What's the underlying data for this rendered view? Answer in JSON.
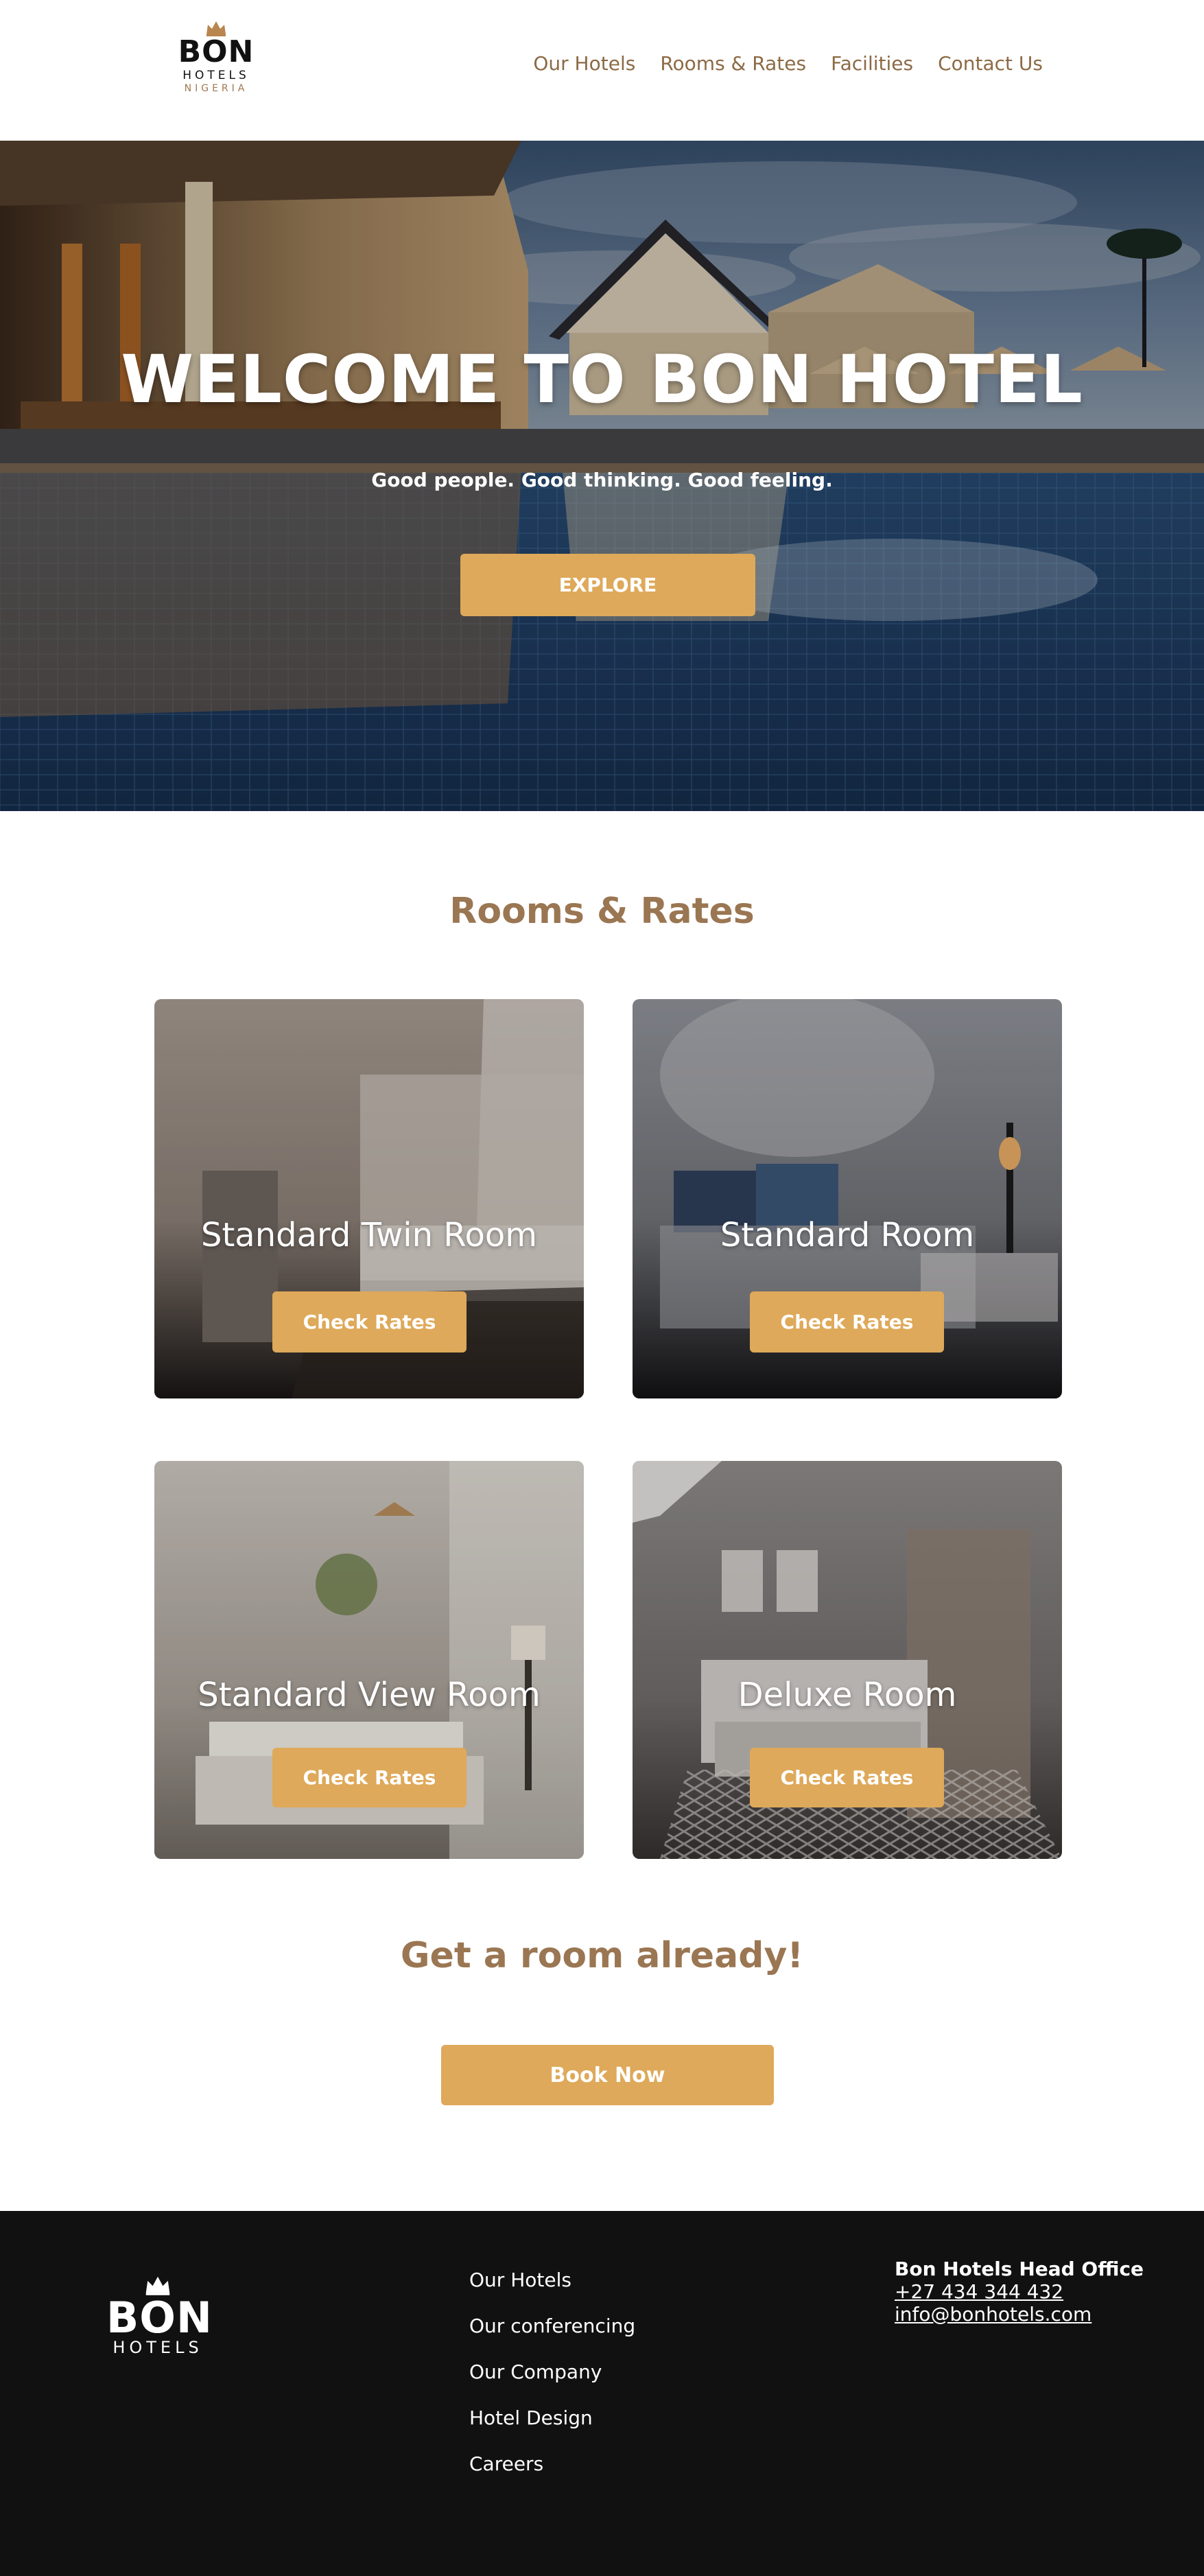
{
  "header": {
    "logo": {
      "line1": "BON",
      "line2": "HOTELS",
      "line3": "NIGERIA"
    },
    "nav": [
      {
        "label": "Our Hotels"
      },
      {
        "label": "Rooms & Rates"
      },
      {
        "label": "Facilities"
      },
      {
        "label": "Contact Us"
      }
    ]
  },
  "hero": {
    "title": "WELCOME TO BON HOTEL",
    "subtitle": "Good people. Good thinking. Good feeling.",
    "button": "EXPLORE"
  },
  "rooms": {
    "title": "Rooms & Rates",
    "cards": [
      {
        "title": "Standard Twin Room",
        "button": "Check Rates"
      },
      {
        "title": "Standard Room",
        "button": "Check Rates"
      },
      {
        "title": "Standard View Room",
        "button": "Check Rates"
      },
      {
        "title": "Deluxe Room",
        "button": "Check Rates"
      }
    ]
  },
  "cta": {
    "title": "Get a room already!",
    "button": "Book Now"
  },
  "footer": {
    "logo": {
      "line1": "BON",
      "line2": "HOTELS"
    },
    "links": [
      {
        "label": "Our Hotels"
      },
      {
        "label": "Our conferencing"
      },
      {
        "label": "Our Company"
      },
      {
        "label": "Hotel Design"
      },
      {
        "label": "Careers"
      }
    ],
    "contact": {
      "office": "Bon Hotels Head Office",
      "phone": "+27 434 344 432",
      "email": "info@bonhotels.com"
    }
  },
  "colors": {
    "accent": "#dea95a",
    "heading": "#9a7652",
    "nav": "#8c6a45",
    "footer_bg": "#111111"
  }
}
